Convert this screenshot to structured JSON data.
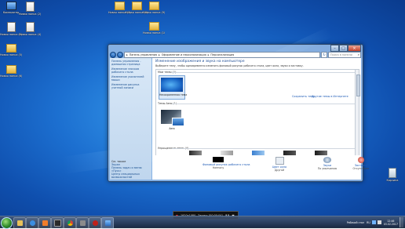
{
  "desktop": {
    "icons": [
      {
        "label": "Компьютер",
        "type": "comp"
      },
      {
        "label": "Новая папка (2)",
        "type": "file"
      },
      {
        "label": "Новая папка (3)",
        "type": "file"
      },
      {
        "label": "Новая папка (4)",
        "type": "file"
      },
      {
        "label": "Новая папка (5)",
        "type": "folder"
      },
      {
        "label": "Новая папка (6)",
        "type": "folder"
      },
      {
        "label": "Новая папка (7)",
        "type": "folder"
      },
      {
        "label": "Новая папка (8)",
        "type": "folder"
      },
      {
        "label": "Новая папка (9)",
        "type": "folder"
      },
      {
        "label": "Новая папка (10)",
        "type": "folder"
      },
      {
        "label": "Корзина",
        "type": "trash"
      }
    ]
  },
  "window": {
    "breadcrumb": [
      "Панель управления",
      "Оформление и персонализация",
      "Персонализация"
    ],
    "search_placeholder": "Поиск в панели управления",
    "sidebar": {
      "links": [
        "Панель управления - домашняя страница",
        "Изменение значков рабочего стола",
        "Изменение указателей мыши",
        "Изменение рисунка учетной записи"
      ],
      "see_also": "См. также",
      "lower_links": [
        "Экран",
        "Панель задач и меню «Пуск»",
        "Центр специальных возможностей"
      ]
    },
    "content": {
      "heading": "Изменение изображения и звука на компьютере",
      "subheading": "Выберите тему, чтобы одновременно изменить фоновый рисунок рабочего стола, цвет окна, звуки и заставку.",
      "my_themes": "Мои темы (1)",
      "unsaved_theme": "Несохраненная тема",
      "save_theme": "Сохранить тему",
      "online_themes": "Другие темы в Интернете",
      "aero_themes": "Темы Aero (1)",
      "aero_theme": "Aero",
      "basic_themes": "Упрощенные темы (4)",
      "bottom": [
        {
          "l1": "Фоновый рисунок рабочего стола",
          "l2": "Harmony"
        },
        {
          "l1": "Цвет окна",
          "l2": "Другой"
        },
        {
          "l1": "Звуки",
          "l2": "По умолчанию"
        },
        {
          "l1": "Заставка",
          "l2": "Отсутствует"
        }
      ]
    }
  },
  "recorder": {
    "resolution": "1920x1080",
    "time": "Запись [00:00:04]"
  },
  "tray": {
    "desktop_label": "Рабочий стол",
    "lang": "RU",
    "time": "12:46",
    "date": "03.02.2017"
  }
}
